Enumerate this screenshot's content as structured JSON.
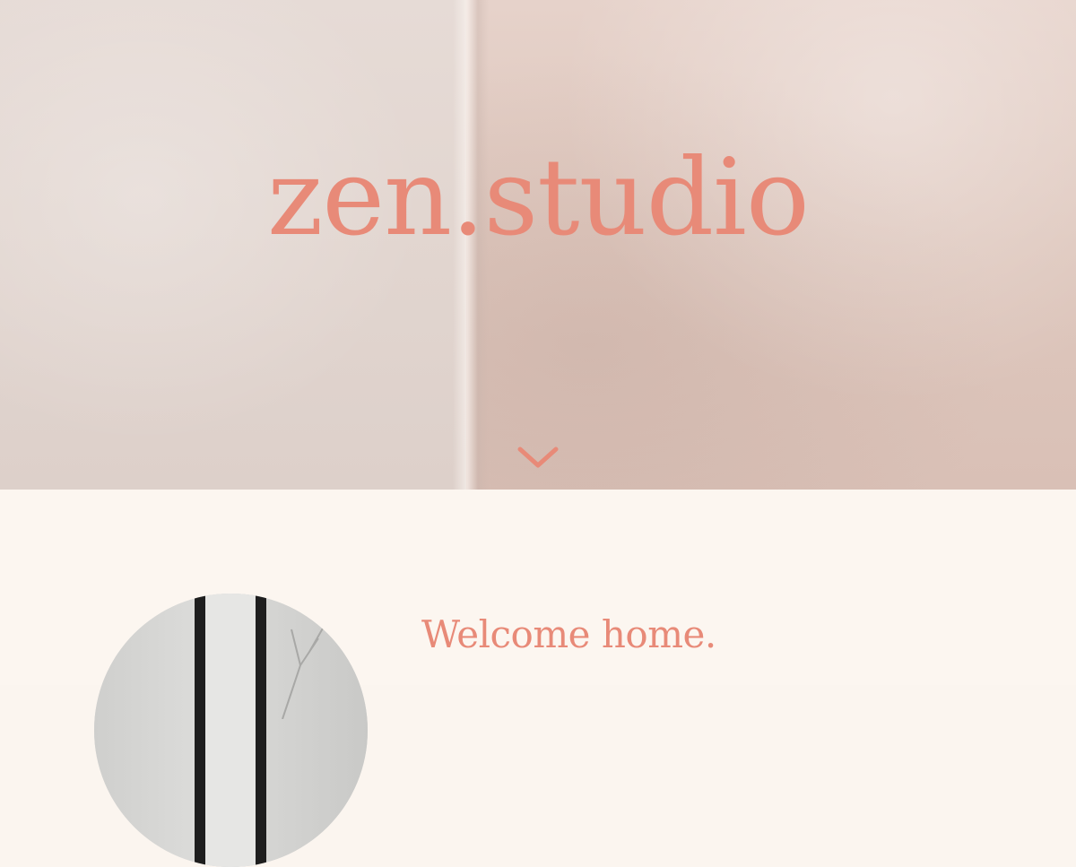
{
  "hero": {
    "title": "zen.studio",
    "scroll_icon": "chevron-down-icon"
  },
  "welcome": {
    "heading": "Welcome home.",
    "body": ""
  },
  "colors": {
    "accent": "#e88a78",
    "page_background": "#fbf5ef"
  }
}
